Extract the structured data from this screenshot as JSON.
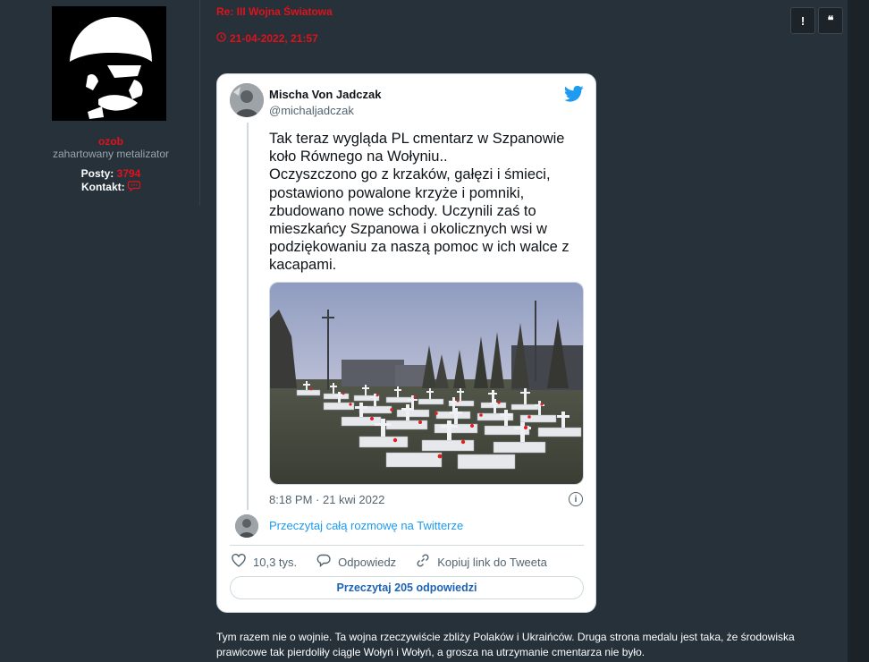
{
  "profile": {
    "username": "ozob",
    "rank": "zahartowany metalizator",
    "posts_label": "Posty:",
    "posts_value": "3794",
    "contact_label": "Kontakt:"
  },
  "post": {
    "title": "Re: III Wojna Światowa",
    "date": "21-04-2022, 21:57",
    "report_label": "!",
    "quote_label": "❝",
    "body": "Tym razem nie o wojnie. Ta wojna rzeczywiście zbliży Polaków i Ukraińców. Druga strona medalu jest taka, że środowiska prawicowe tak pierdoliły ciągle Wołyń i Wołyń, a grosza na utrzymanie cmentarza nie było."
  },
  "tweet": {
    "name": "Mischa Von Jadczak",
    "handle": "@michaljadczak",
    "text": "Tak teraz wygląda PL cmentarz w Szpanowie\nkoło Równego na Wołyniu..\nOczyszczono go z krzaków, gałęzi i śmieci,\npostawiono powalone krzyże i pomniki,\nzbudowano nowe schody. Uczynili zaś to\nmieszkańcy Szpanowa i okolicznych wsi w\npodziękowaniu za naszą pomoc w ich walce z\nkacapami.",
    "timestamp": "8:18 PM · 21 kwi 2022",
    "info_label": "i",
    "read_conversation": "Przeczytaj całą rozmowę na Twitterze",
    "likes": "10,3 tys.",
    "reply_label": "Odpowiedz",
    "copy_link_label": "Kopiuj link do Tweeta",
    "read_replies": "Przeczytaj 205 odpowiedzi"
  },
  "colors": {
    "accent_red": "#e0121b",
    "twitter_blue": "#1d9bf0"
  }
}
